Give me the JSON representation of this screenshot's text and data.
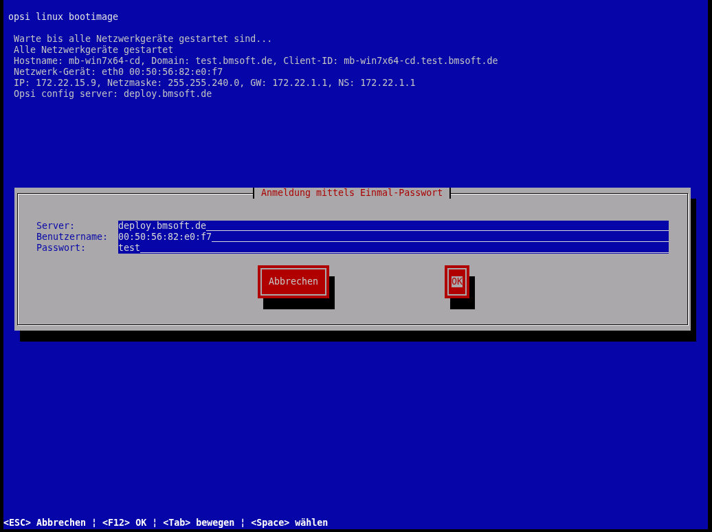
{
  "header": {
    "title": "opsi linux bootimage"
  },
  "log_lines": [
    "Warte bis alle Netzwerkgeräte gestartet sind...",
    "Alle Netzwerkgeräte gestartet",
    "Hostname: mb-win7x64-cd, Domain: test.bmsoft.de, Client-ID: mb-win7x64-cd.test.bmsoft.de",
    "Netzwerk-Gerät: eth0 00:50:56:82:e0:f7",
    "IP: 172.22.15.9, Netzmaske: 255.255.240.0, GW: 172.22.1.1, NS: 172.22.1.1",
    "Opsi config server: deploy.bmsoft.de"
  ],
  "dialog": {
    "title": "Anmeldung mittels Einmal-Passwort",
    "fields": [
      {
        "label": "Server:",
        "value": "deploy.bmsoft.de"
      },
      {
        "label": "Benutzername:",
        "value": "00:50:56:82:e0:f7"
      },
      {
        "label": "Passwort:",
        "value": "test"
      }
    ],
    "buttons": [
      {
        "label": "Abbrechen",
        "selected": false
      },
      {
        "label": "OK",
        "selected": true
      }
    ]
  },
  "status_bar": {
    "text": "<ESC> Abbrechen ¦ <F12> OK ¦ <Tab> bewegen ¦ <Space> wählen"
  }
}
